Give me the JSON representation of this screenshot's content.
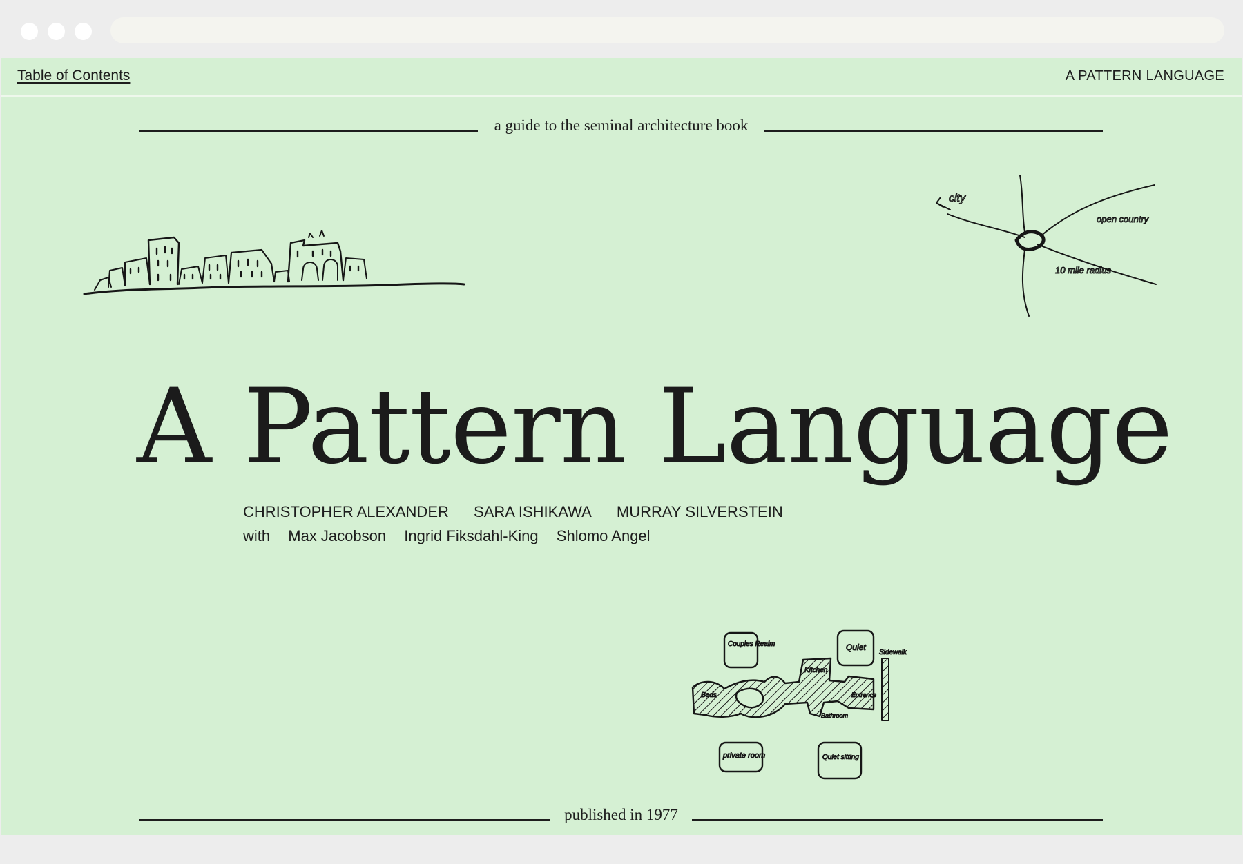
{
  "browser": {
    "controls": [
      "close-dot",
      "minimize-dot",
      "maximize-dot"
    ]
  },
  "nav": {
    "toc_link": "Table of Contents",
    "brand": "A PATTERN LANGUAGE"
  },
  "hero": {
    "tagline": "a guide to the seminal architecture book",
    "title": "A Pattern Language",
    "authors": [
      "CHRISTOPHER ALEXANDER",
      "SARA ISHIKAWA",
      "MURRAY SILVERSTEIN"
    ],
    "with_label": "with",
    "contributors": [
      "Max Jacobson",
      "Ingrid Fiksdahl-King",
      "Shlomo Angel"
    ],
    "published": "published in 1977"
  },
  "sketches": {
    "town": "hand-drawn town skyline",
    "network": {
      "labels": [
        "city",
        "open country",
        "10 mile radius"
      ]
    },
    "plan": {
      "labels": [
        "Couples Realm",
        "Quiet",
        "Kitchen",
        "Sidewalk",
        "Beds",
        "Entrance",
        "Bathroom",
        "private room",
        "Quiet sitting"
      ]
    }
  },
  "colors": {
    "page_background": "#d5f0d3",
    "ink": "#1b1b1b",
    "chrome": "#ededed"
  }
}
